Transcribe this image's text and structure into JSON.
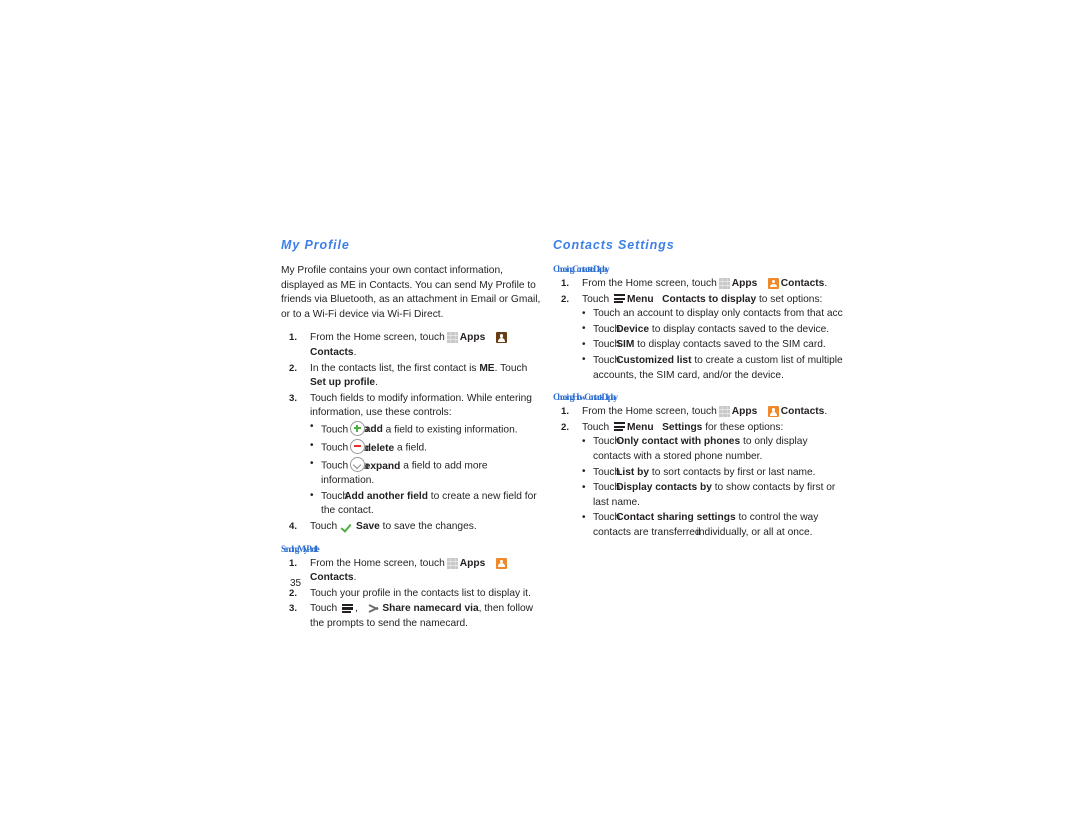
{
  "document": {
    "page_number": "35",
    "accent_heading_color": "#3d7fe8",
    "subheading_color": "#2f6fd0",
    "body_color": "#231f20"
  },
  "left_column": {
    "section_title": "My Profile",
    "intro_paragraph": "My Profile contains your own contact information, displayed as ME in Contacts. You can send My Profile to friends via Bluetooth, as an attachment in Email or Gmail, or to a Wi-Fi device via Wi-Fi Direct.",
    "steps": [
      {
        "number": "1.",
        "lead": "From the Home screen, touch",
        "apps_icon": "apps-grid-icon",
        "apps_label": "Apps",
        "contacts_icon": "contacts-icon",
        "contacts_label": "Contacts",
        "trailing": "."
      },
      {
        "number": "2.",
        "part1": "In the contacts list, the first contact is ",
        "bold1": "ME",
        "part2": ". Touch ",
        "bold2": "Set up profile",
        "part3": "."
      },
      {
        "number": "3.",
        "text": "Touch fields to modify information. While entering information, use these controls:",
        "bullets": [
          {
            "lead": "Touch",
            "icon": "plus-circle-icon",
            "mid": "to",
            "bold": "add",
            "tail": "a field to existing information."
          },
          {
            "lead": "Touch",
            "icon": "minus-circle-icon",
            "mid": "to",
            "bold": "delete",
            "tail": "a field."
          },
          {
            "lead": "Touch",
            "icon": "chevron-down-circle-icon",
            "mid": "to",
            "bold": "expand",
            "tail": "a field to add more information."
          },
          {
            "lead": "Touch",
            "icon": "",
            "mid": "",
            "bold": "Add another field",
            "tail": "to create a new field for the contact."
          }
        ]
      },
      {
        "number": "4.",
        "lead": "Touch",
        "check_icon": "check-icon",
        "bold": "Save",
        "tail": "to save the changes."
      }
    ],
    "subsection": {
      "title": "Sending My Profile",
      "steps": [
        {
          "number": "1.",
          "lead": "From the Home screen, touch",
          "apps_icon": "apps-grid-icon",
          "apps_label": "Apps",
          "contacts_icon": "contacts-icon",
          "contacts_label": "Contacts",
          "trailing": "."
        },
        {
          "number": "2.",
          "text": "Touch your profile in the contacts list to display it."
        },
        {
          "number": "3.",
          "lead": "Touch",
          "menu_icon": "menu-icon",
          "comma": ",",
          "share_icon": "share-icon",
          "bold": "Share namecard via",
          "tail": ", then follow the prompts to send the namecard."
        }
      ]
    }
  },
  "right_column": {
    "section_title": "Contacts Settings",
    "subsections": [
      {
        "title": "Choosing Contacts to Display",
        "steps": [
          {
            "number": "1.",
            "lead": "From the Home screen, touch",
            "apps_icon": "apps-grid-icon",
            "apps_label": "Apps",
            "contacts_icon": "contacts-icon",
            "contacts_label": "Contacts",
            "trailing": "."
          },
          {
            "number": "2.",
            "lead": "Touch",
            "menu_icon": "menu-icon",
            "menu_label": "Menu",
            "bold": "Contacts to display",
            "tail": "to set options:"
          }
        ],
        "bullets": [
          {
            "lead": "Touch an account to display only contacts from that account.",
            "bold": "",
            "tail": ""
          },
          {
            "lead": "Touch",
            "mid": "",
            "bold": "Device",
            "tail": "to display contacts saved to the device."
          },
          {
            "lead": "Touch",
            "mid": "",
            "bold": "SIM",
            "tail": "to display contacts saved to the SIM card."
          },
          {
            "lead": "Touch",
            "mid": "",
            "bold": "Customized list",
            "tail": "to create a custom list of multiple accounts, the SIM card, and/or the device."
          }
        ]
      },
      {
        "title": "Choosing How Contacts Display",
        "steps": [
          {
            "number": "1.",
            "lead": "From the Home screen, touch",
            "apps_icon": "apps-grid-icon",
            "apps_label": "Apps",
            "contacts_icon": "contacts-icon",
            "contacts_label": "Contacts",
            "trailing": "."
          },
          {
            "number": "2.",
            "lead": "Touch",
            "menu_icon": "menu-icon",
            "menu_label": "Menu",
            "bold": "Settings",
            "tail": "for these options:"
          }
        ],
        "bullets": [
          {
            "lead": "Touch",
            "bold": "Only contact with phones",
            "tail": "to only display contacts with a stored phone number."
          },
          {
            "lead": "Touch",
            "bold": "List by",
            "tail": "to sort contacts by first or last name."
          },
          {
            "lead": "Touch",
            "bold": "Display contacts by",
            "tail": "to show contacts by first or last name."
          },
          {
            "lead": "Touch",
            "bold": "Contact sharing settings",
            "tail": "to control the way contacts are transferred",
            "tail2": "individually, or all at once."
          }
        ]
      }
    ]
  }
}
